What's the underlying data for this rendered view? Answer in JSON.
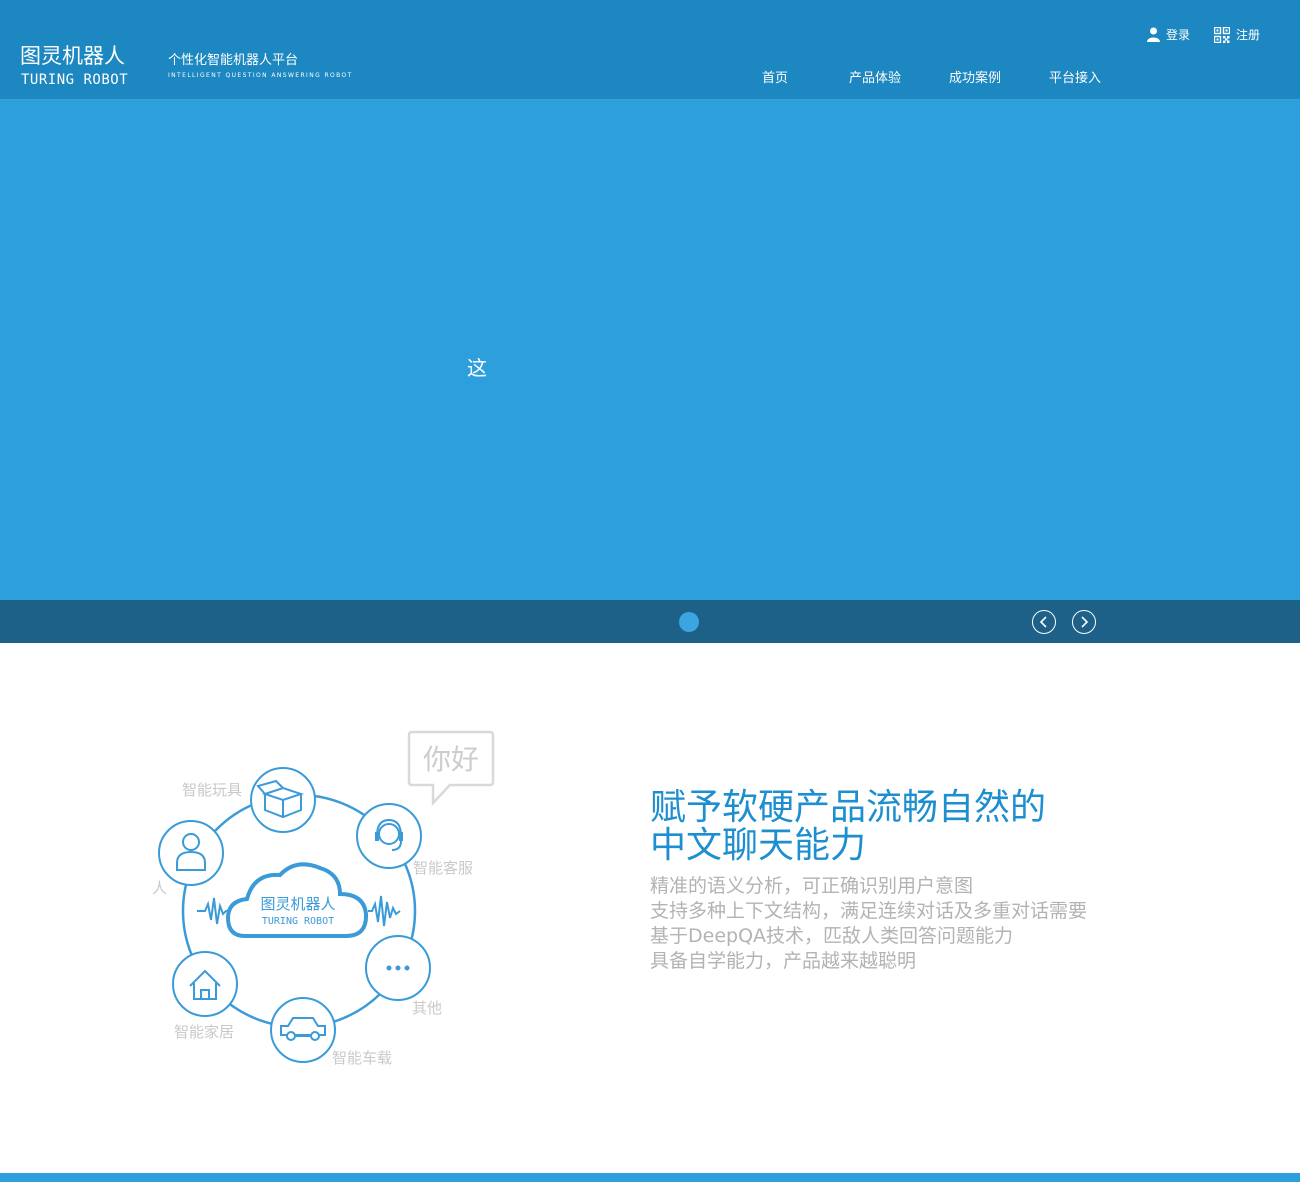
{
  "header": {
    "logo_cn": "图灵机器人",
    "logo_en": "TURING ROBOT",
    "slogan_cn": "个性化智能机器人平台",
    "slogan_en": "INTELLIGENT QUESTION ANSWERING ROBOT",
    "login_label": "登录",
    "register_label": "注册",
    "nav": [
      "首页",
      "产品体验",
      "成功案例",
      "平台接入"
    ]
  },
  "banner": {
    "text": "这"
  },
  "feature": {
    "diagram": {
      "bubble_text": "你好",
      "center_cn": "图灵机器人",
      "center_en": "TURING ROBOT",
      "labels": {
        "toy": "智能玩具",
        "service": "智能客服",
        "robot": "人",
        "home": "智能家居",
        "car": "智能车载",
        "other": "其他"
      }
    },
    "title_line1": "赋予软硬产品流畅自然的",
    "title_line2": "中文聊天能力",
    "desc": [
      "精准的语义分析，可正确识别用户意图",
      "支持多种上下文结构，满足连续对话及多重对话需要",
      "基于DeepQA技术，匹敌人类回答问题能力",
      "具备自学能力，产品越来越聪明"
    ]
  },
  "colors": {
    "header_bg": "#1c87c0",
    "banner_bg": "#2e9fdd",
    "slider_bar_bg": "#1d6088",
    "accent": "#1d8fd0",
    "desc_text": "#b3b3b3"
  }
}
